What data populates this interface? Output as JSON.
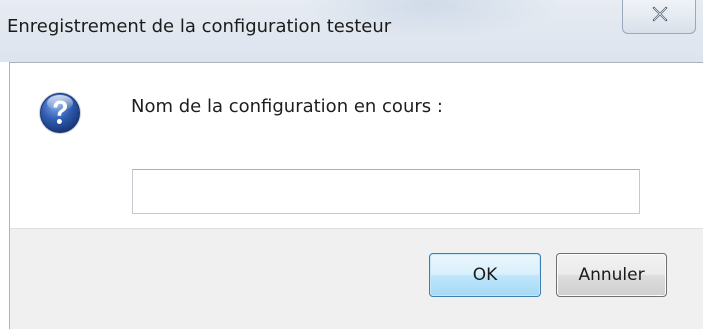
{
  "dialog": {
    "title": "Enregistrement de la configuration testeur",
    "prompt": "Nom de la configuration en cours :",
    "input_value": "",
    "input_placeholder": "",
    "icon": "question-icon"
  },
  "buttons": {
    "ok_label": "OK",
    "cancel_label": "Annuler",
    "close_icon": "close-icon"
  },
  "colors": {
    "titlebar": "#e2e8f0",
    "footer": "#f0f0f0",
    "ok_border": "#3c7fb1",
    "icon_blue": "#2a4f9a"
  }
}
